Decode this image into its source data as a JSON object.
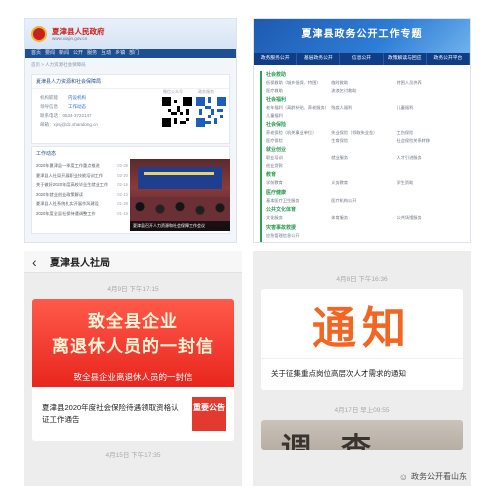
{
  "site": {
    "title": "夏津县人民政府",
    "domain": "www.xiajin.gov.cn",
    "nav": [
      "首页",
      "要闻",
      "新闻",
      "公开",
      "服务",
      "互动",
      "乡镇",
      "部门"
    ],
    "breadcrumb": "首页 > 人力资源社会保障局",
    "info_title": "夏津县人力资源和社会保障局",
    "info_lines": [
      {
        "label": "机构职能",
        "link": "内设机构"
      },
      {
        "label": "领导信息",
        "link": "工作动态"
      },
      {
        "label": "联系电话：0534-3722147",
        "link": ""
      },
      {
        "label": "邮箱：xjrsj@dz.shandong.cn",
        "link": ""
      }
    ],
    "qr_labels": [
      "微信公众号",
      "政务服务"
    ],
    "news_title": "工作动态",
    "news": [
      {
        "t": "2020年夏津县一季度工作重点推进",
        "d": "02-28"
      },
      {
        "t": "夏津县人社局开展职业技能培训工作",
        "d": "02-20"
      },
      {
        "t": "关于做好2020年度高校毕业生就业工作",
        "d": "02-16"
      },
      {
        "t": "2020年就业创业政策解读",
        "d": "02-10"
      },
      {
        "t": "夏津县人社系统扎实开展作风建设",
        "d": "01-28"
      },
      {
        "t": "2020年度全县社保待遇调整工作",
        "d": "01-16"
      }
    ],
    "photo_caption": "夏津县召开人力资源和社会保障工作会议"
  },
  "topic": {
    "title": "夏津县政务公开工作专题",
    "tabs": [
      "政务服务公开",
      "基层政务公开",
      "信息公开",
      "政策解读与回应",
      "政务公开平台"
    ],
    "sections": [
      {
        "name": "社会救助",
        "rows": [
          [
            "低保救助（城乡低保、特困）",
            "临时救助",
            "特困人员供养"
          ],
          [
            "医疗救助",
            "流浪乞讨救助",
            ""
          ]
        ]
      },
      {
        "name": "社会福利",
        "rows": [
          [
            "老年福利（高龄补贴、养老服务）",
            "残疾人福利",
            "儿童福利"
          ],
          [
            "儿童福利",
            "",
            ""
          ]
        ]
      },
      {
        "name": "社会保险",
        "rows": [
          [
            "养老保险（机关事业单位）",
            "失业保险（领取失业金）",
            "工伤保险"
          ],
          [
            "医疗保险",
            "生育保险",
            "社会保险关系转移"
          ]
        ]
      },
      {
        "name": "就业创业",
        "rows": [
          [
            "职业培训",
            "就业服务",
            "人才引进服务"
          ],
          [
            "创业贷款",
            "",
            ""
          ]
        ]
      },
      {
        "name": "教育",
        "rows": [
          [
            "学前教育",
            "义务教育",
            "学生资助"
          ]
        ]
      },
      {
        "name": "医疗健康",
        "rows": [
          [
            "基本医疗卫生服务",
            "医疗机构公开",
            ""
          ]
        ]
      },
      {
        "name": "公共文化体育",
        "rows": [
          [
            "文化服务",
            "体育服务",
            "公共场馆服务"
          ]
        ]
      },
      {
        "name": "灾害事故救援",
        "rows": [
          [
            "应急管理信息公开",
            "",
            ""
          ]
        ]
      }
    ]
  },
  "article": {
    "account": "夏津县人社局",
    "time1": "4月9日 下午17:15",
    "banner_l1": "致全县企业",
    "banner_l2": "离退休人员的一封信",
    "banner_l3": "致全县企业离退休人员的一封信",
    "subtitle": "夏津县2020年度社会保险待遇领取资格认证工作通告",
    "stamp": "重要公告",
    "time2": "4月15日 下午17:35"
  },
  "notice": {
    "time1": "4月8日 下午16:36",
    "banner_text": "通知",
    "subtitle": "关于征集重点岗位高层次人才需求的通知",
    "time2": "4月17日 早上09:55",
    "banner2_text": "调查",
    "watermark": "政务公开看山东"
  },
  "colors": {
    "gov_red": "#c8201c",
    "nav_blue": "#1e4f93",
    "topic_green": "#2e9d55",
    "banner_red": "#e8261e",
    "notice_orange": "#f26522"
  }
}
